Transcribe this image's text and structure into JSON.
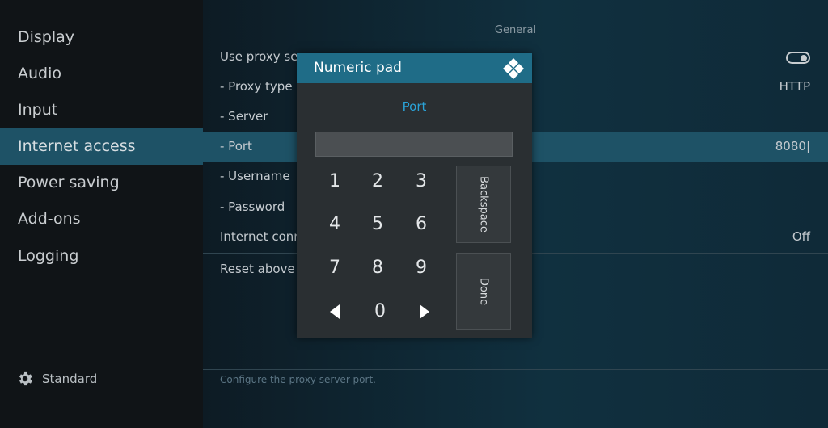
{
  "sidebar": {
    "items": [
      {
        "label": "Display"
      },
      {
        "label": "Audio"
      },
      {
        "label": "Input"
      },
      {
        "label": "Internet access"
      },
      {
        "label": "Power saving"
      },
      {
        "label": "Add-ons"
      },
      {
        "label": "Logging"
      }
    ],
    "active_index": 3,
    "footer_label": "Standard",
    "footer_icon": "gear-icon"
  },
  "main": {
    "section_title": "General",
    "rows": [
      {
        "label": "Use proxy ser",
        "control": "toggle",
        "toggle_on": true
      },
      {
        "label": "- Proxy type",
        "value": "HTTP"
      },
      {
        "label": "- Server",
        "value": ""
      },
      {
        "label": "- Port",
        "value": "8080|"
      },
      {
        "label": "- Username",
        "value": ""
      },
      {
        "label": "- Password",
        "value": ""
      },
      {
        "label": "Internet conn",
        "value": "Off"
      },
      {
        "label": "Reset above s",
        "value": ""
      }
    ],
    "description": "Configure the proxy server port."
  },
  "dialog": {
    "title": "Numeric pad",
    "field_label": "Port",
    "input_value": "",
    "keys": {
      "k1": "1",
      "k2": "2",
      "k3": "3",
      "k4": "4",
      "k5": "5",
      "k6": "6",
      "k7": "7",
      "k8": "8",
      "k9": "9",
      "k0": "0"
    },
    "backspace_label": "Backspace",
    "done_label": "Done",
    "left_icon": "arrow-left-icon",
    "right_icon": "arrow-right-icon"
  },
  "colors": {
    "accent": "#1f6c87",
    "selection": "#1e5266",
    "label_blue": "#2aa3d8"
  }
}
